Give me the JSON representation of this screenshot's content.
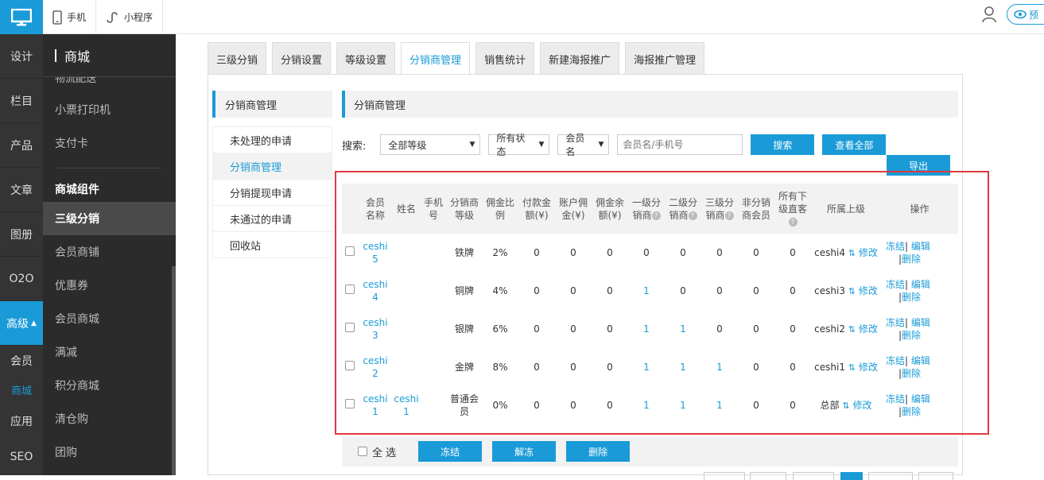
{
  "topbar": {
    "device_phone": "手机",
    "device_mini": "小程序",
    "preview_label": "预"
  },
  "leftnav": {
    "items": [
      "设计",
      "栏目",
      "产品",
      "文章",
      "图册",
      "O2O"
    ],
    "active": "高级",
    "subs": [
      "会员",
      "商城"
    ],
    "after": [
      "应用",
      "SEO"
    ]
  },
  "subnav": {
    "title": "商城",
    "rows_top": [
      "物流配送",
      "小票打印机",
      "支付卡"
    ],
    "group_title": "商城组件",
    "rows": [
      "三级分销",
      "会员商铺",
      "优惠券",
      "会员商城",
      "满减",
      "积分商城",
      "清仓购",
      "团购"
    ]
  },
  "tabs": [
    "三级分销",
    "分销设置",
    "等级设置",
    "分销商管理",
    "销售统计",
    "新建海报推广",
    "海报推广管理"
  ],
  "side_menu": {
    "title": "分销商管理",
    "items": [
      "未处理的申请",
      "分销商管理",
      "分销提现申请",
      "未通过的申请",
      "回收站"
    ]
  },
  "content_title": "分销商管理",
  "search": {
    "label": "搜索:",
    "level": "全部等级",
    "status": "所有状态",
    "field": "会员名",
    "placeholder": "会员名/手机号",
    "search_btn": "搜索",
    "view_all_btn": "查看全部",
    "export_btn": "导出"
  },
  "table": {
    "headers": {
      "member": [
        "会员",
        "名称"
      ],
      "name": "姓名",
      "phone": [
        "手机",
        "号"
      ],
      "level": [
        "分销商",
        "等级"
      ],
      "rate": [
        "佣金比",
        "例"
      ],
      "paid": [
        "付款金",
        "额(¥)"
      ],
      "account": [
        "账户佣",
        "金(¥)"
      ],
      "balance": [
        "佣金余",
        "额(¥)"
      ],
      "l1": [
        "一级分",
        "销商"
      ],
      "l2": [
        "二级分",
        "销商"
      ],
      "l3": [
        "三级分",
        "销商"
      ],
      "non": [
        "非分销",
        "商会员"
      ],
      "direct": [
        "所有下",
        "级直客"
      ],
      "parent": "所属上级",
      "ops": "操作"
    },
    "rows": [
      {
        "member": [
          "ceshi",
          "5"
        ],
        "name": [
          "",
          ""
        ],
        "level": [
          "铁牌",
          ""
        ],
        "rate": "2%",
        "paid": "0",
        "account": "0",
        "balance": "0",
        "l1": "0",
        "l2": "0",
        "l3": "0",
        "non": "0",
        "direct": "0",
        "parent": "ceshi4"
      },
      {
        "member": [
          "ceshi",
          "4"
        ],
        "name": [
          "",
          ""
        ],
        "level": [
          "铜牌",
          ""
        ],
        "rate": "4%",
        "paid": "0",
        "account": "0",
        "balance": "0",
        "l1": "1",
        "l2": "0",
        "l3": "0",
        "non": "0",
        "direct": "0",
        "parent": "ceshi3"
      },
      {
        "member": [
          "ceshi",
          "3"
        ],
        "name": [
          "",
          ""
        ],
        "level": [
          "银牌",
          ""
        ],
        "rate": "6%",
        "paid": "0",
        "account": "0",
        "balance": "0",
        "l1": "1",
        "l2": "1",
        "l3": "0",
        "non": "0",
        "direct": "0",
        "parent": "ceshi2"
      },
      {
        "member": [
          "ceshi",
          "2"
        ],
        "name": [
          "",
          ""
        ],
        "level": [
          "金牌",
          ""
        ],
        "rate": "8%",
        "paid": "0",
        "account": "0",
        "balance": "0",
        "l1": "1",
        "l2": "1",
        "l3": "1",
        "non": "0",
        "direct": "0",
        "parent": "ceshi1"
      },
      {
        "member": [
          "ceshi",
          "1"
        ],
        "name": [
          "ceshi",
          "1"
        ],
        "level": [
          "普通会",
          "员"
        ],
        "rate": "0%",
        "paid": "0",
        "account": "0",
        "balance": "0",
        "l1": "1",
        "l2": "1",
        "l3": "1",
        "non": "0",
        "direct": "0",
        "parent": "总部"
      }
    ],
    "modify": "修改",
    "freeze": "冻结",
    "edit": "编辑",
    "delete": "删除",
    "sep": "|"
  },
  "bottom": {
    "select_all": "全 选",
    "freeze": "冻结",
    "unfreeze": "解冻",
    "delete": "删除"
  },
  "colors": {
    "accent": "#1a9bd7",
    "highlight_box": "#e0393e"
  }
}
